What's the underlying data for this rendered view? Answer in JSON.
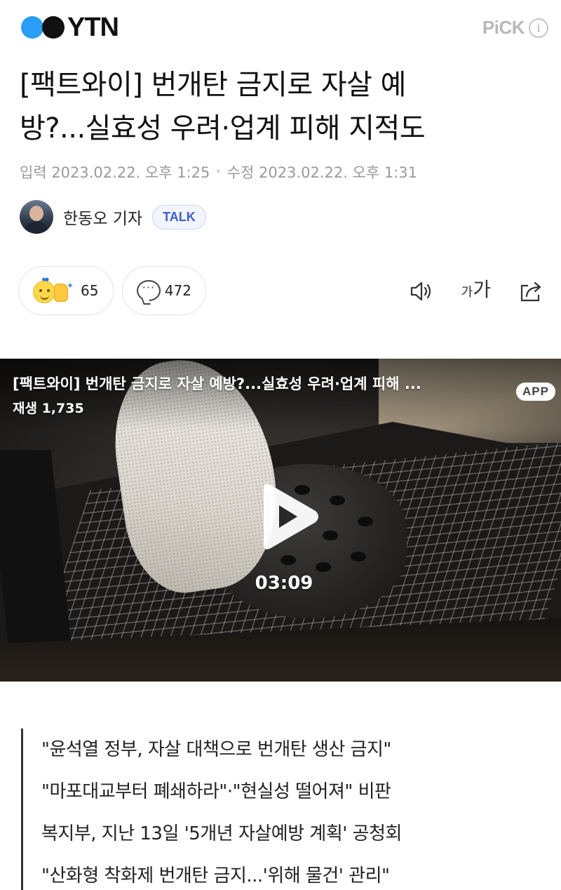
{
  "header": {
    "logo_text": "YTN",
    "pick_label": "PiCK",
    "info_label": "i"
  },
  "article": {
    "title_line1": "[팩트와이] 번개탄 금지로 자살 예",
    "title_line2": "방?...실효성 우려·업계 피해 지적도",
    "published": "입력 2023.02.22. 오후 1:25",
    "modified": "수정 2023.02.22. 오후 1:31",
    "date_separator": "•",
    "author_name": "한동오 기자",
    "talk_label": "TALK"
  },
  "actions": {
    "reaction_count": "65",
    "comment_count": "472",
    "font_small": "가",
    "font_large": "가"
  },
  "video": {
    "title": "[팩트와이] 번개탄 금지로 자살 예방?...실효성 우려·업계 피해 ...",
    "views": "재생 1,735",
    "app_badge": "APP",
    "duration": "03:09"
  },
  "summary": {
    "lines": [
      "\"윤석열 정부, 자살 대책으로 번개탄 생산 금지\"",
      "\"마포대교부터 폐쇄하라\"·\"현실성 떨어져\" 비판",
      "복지부, 지난 13일 '5개년 자살예방 계획' 공청회",
      "\"산화형 착화제 번개탄 금지...'위해 물건' 관리\""
    ]
  },
  "colors": {
    "logo_blue": "#2a9df4",
    "talk_blue": "#3a60c9",
    "meta_gray": "#9a9a9a"
  }
}
